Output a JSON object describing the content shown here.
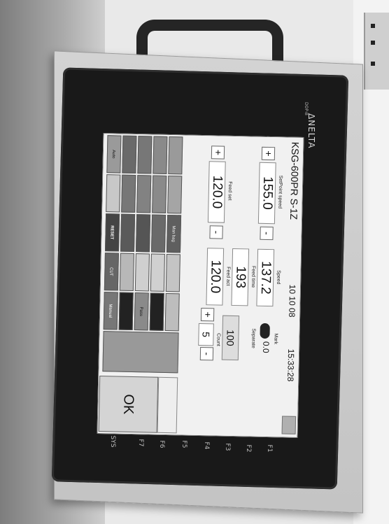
{
  "device": {
    "brand": "ΔNELTA",
    "model_text": "DOP-B",
    "function_keys": [
      "F1",
      "F2",
      "F3",
      "F4",
      "F5",
      "F6",
      "F7",
      "SYS"
    ]
  },
  "screen": {
    "title": "KSG-600PR S-1Z",
    "date": "10 10 08",
    "time": "15:33:28",
    "setpoint_speed": {
      "label": "SetPoint speed",
      "value": "155.0"
    },
    "speed": {
      "label": "Speed",
      "value": "137.2"
    },
    "feed_time": {
      "label": "Feed time",
      "value": "193"
    },
    "feed_set": {
      "label": "Feed set",
      "value": "120.0"
    },
    "feed_act": {
      "label": "Feed act",
      "value": "120.0"
    },
    "mark": {
      "label": "Mark",
      "value": "0.0"
    },
    "separate": {
      "label": "Separate",
      "value": "100"
    },
    "count": {
      "label": "Count",
      "value": "5"
    },
    "plus": "+",
    "minus": "-",
    "buttons": {
      "reset": "RESET",
      "cut": "CUT",
      "ok": "OK",
      "pass": "Pass",
      "manual": "Manual",
      "man_bag": "Man bag",
      "auto": "Auto"
    }
  },
  "colors": {
    "screen_bg": "#f1f1f1",
    "bezel": "#191919",
    "housing": "#cbcbcb",
    "button_dark": "#5f5f5f",
    "button_light": "#bdbdbd"
  }
}
